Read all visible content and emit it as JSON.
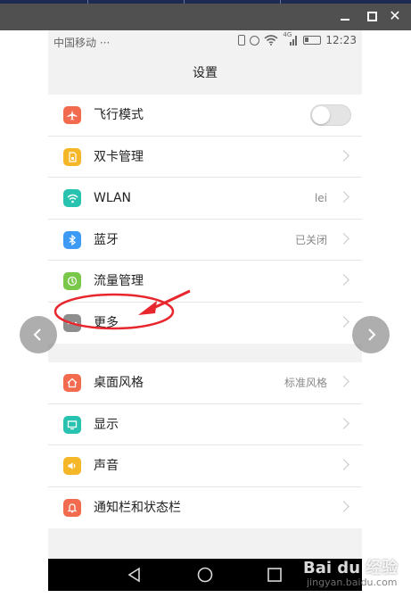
{
  "status_bar": {
    "carrier": "中国移动 ···",
    "network_type": "4G",
    "time": "12:23"
  },
  "page": {
    "title": "设置"
  },
  "settings_group_1": [
    {
      "label": "飞行模式",
      "icon": "airplane-icon",
      "color": "#f26b4f",
      "control": "toggle",
      "toggle_on": false
    },
    {
      "label": "双卡管理",
      "icon": "sim-card-icon",
      "color": "#f5b728",
      "control": "chevron"
    },
    {
      "label": "WLAN",
      "icon": "wifi-icon",
      "color": "#27c2b0",
      "value": "lei",
      "control": "chevron"
    },
    {
      "label": "蓝牙",
      "icon": "bluetooth-icon",
      "color": "#3d9bf5",
      "value": "已关闭",
      "control": "chevron"
    },
    {
      "label": "流量管理",
      "icon": "data-usage-icon",
      "color": "#79c84a",
      "control": "chevron"
    },
    {
      "label": "更多",
      "icon": "more-dots-icon",
      "color": "#8e8e8e",
      "control": "chevron"
    }
  ],
  "settings_group_2": [
    {
      "label": "桌面风格",
      "icon": "home-icon",
      "color": "#f26b4f",
      "value": "标准风格",
      "control": "chevron"
    },
    {
      "label": "显示",
      "icon": "display-icon",
      "color": "#27c2b0",
      "control": "chevron"
    },
    {
      "label": "声音",
      "icon": "sound-icon",
      "color": "#f5b728",
      "control": "chevron"
    },
    {
      "label": "通知栏和状态栏",
      "icon": "notification-icon",
      "color": "#f26b4f",
      "control": "chevron"
    }
  ],
  "watermark": {
    "brand": "Bai du 经验",
    "site": "jingyan.baidu.com"
  },
  "colors": {
    "annotation": "#e8262d",
    "navbar": "#000000",
    "viewer_bar": "#505050"
  }
}
